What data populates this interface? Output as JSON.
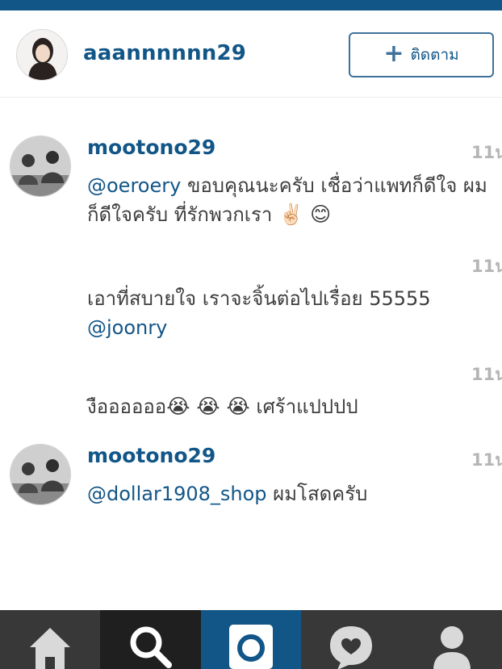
{
  "header": {
    "username": "aaannnnnn29",
    "follow_label": "ติดตาม",
    "follow_plus": "+"
  },
  "comments": [
    {
      "username": "mootono29",
      "time": "11น",
      "mention": "@oeroery",
      "text": " ขอบคุณนะครับ เชื่อว่าแพทก็ดีใจ ผมก็ดีใจครับ ที่รักพวกเรา",
      "emoji": "✌🏻 😊"
    },
    {
      "username": "",
      "time": "11น",
      "text": "เอาที่สบายใจ เราจะจิ้นต่อไปเรื่อย 55555",
      "mention": "@joonry"
    },
    {
      "username": "",
      "time": "11น",
      "text": "งืออออออ",
      "emoji": "😭 😭 😭",
      "text_after": " เศร้าแปปปป"
    },
    {
      "username": "mootono29",
      "time": "11น",
      "mention": "@dollar1908_shop",
      "text": " ผมโสดครับ"
    }
  ],
  "tabbar": {
    "tabs": [
      "home-icon",
      "search-icon",
      "camera-icon",
      "activity-icon",
      "profile-icon"
    ],
    "active": "camera-icon"
  },
  "colors": {
    "brand": "#125688",
    "tabbar": "#383838",
    "time": "#b5b5b5"
  }
}
